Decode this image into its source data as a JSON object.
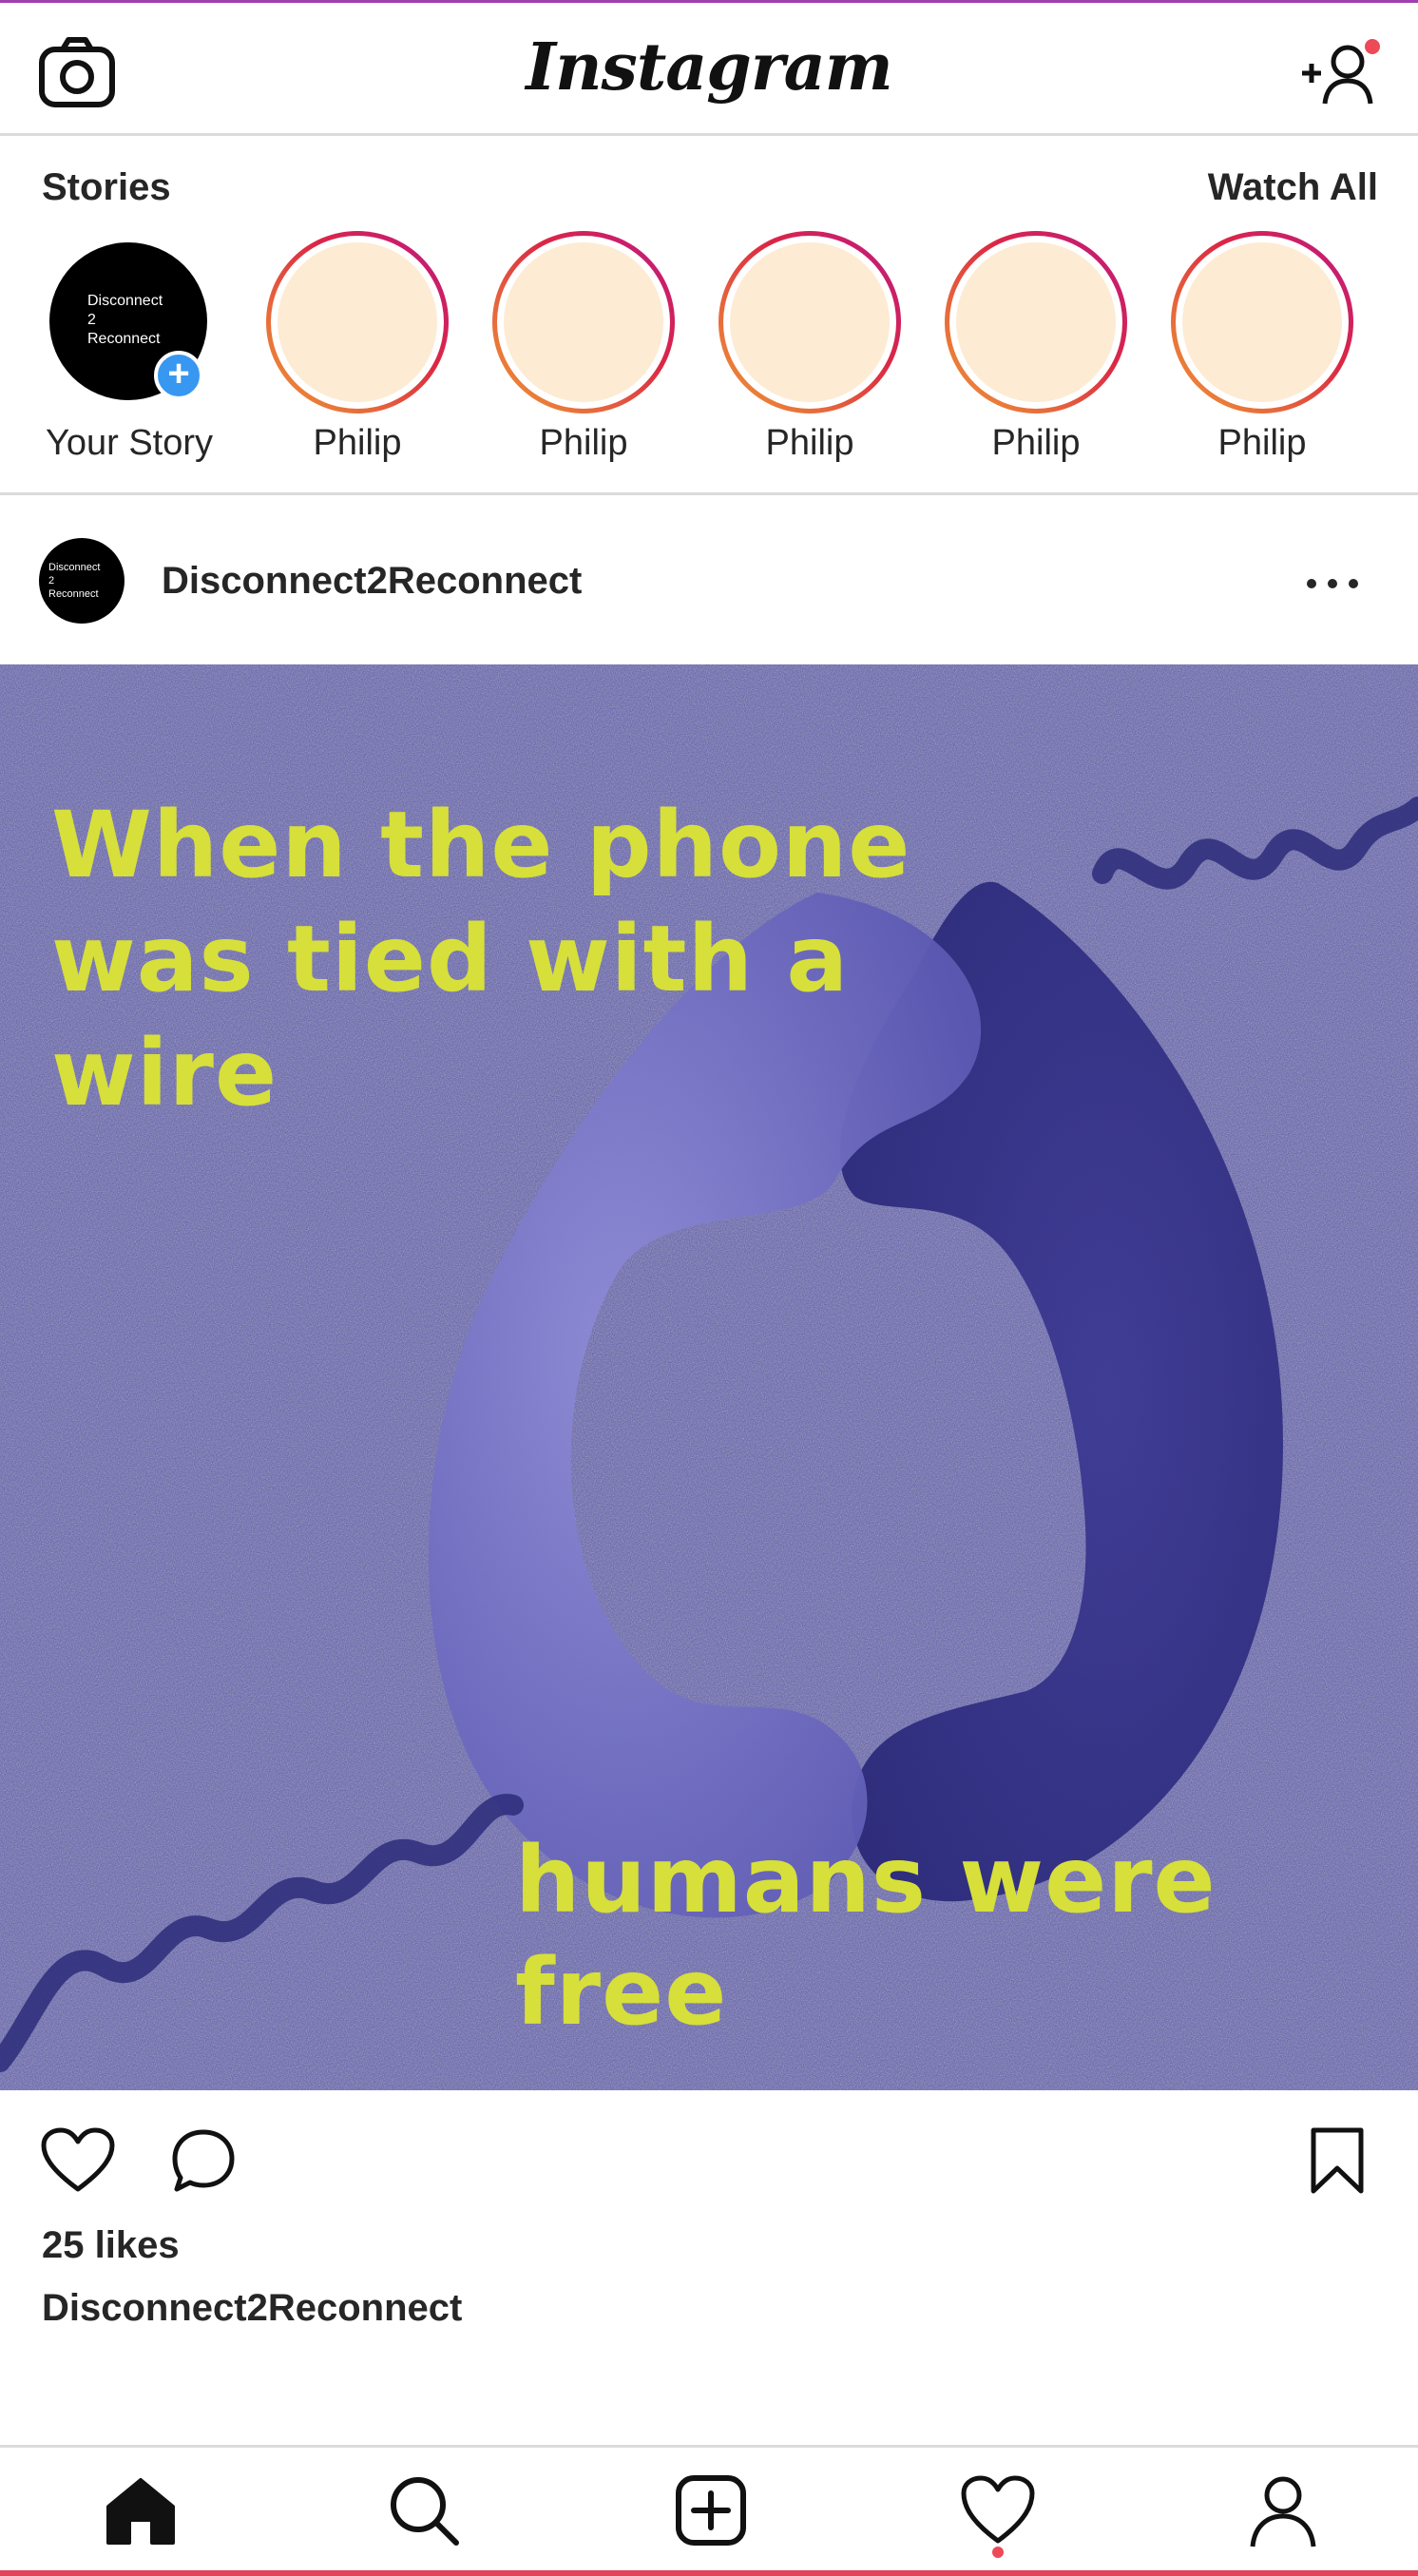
{
  "header": {
    "logo_text": "Instagram"
  },
  "stories": {
    "title": "Stories",
    "watch_all": "Watch All",
    "your_story": {
      "label": "Your Story",
      "avatar_text": [
        "Disconnect",
        "2",
        "Reconnect"
      ]
    },
    "items": [
      {
        "name": "Philip"
      },
      {
        "name": "Philip"
      },
      {
        "name": "Philip"
      },
      {
        "name": "Philip"
      },
      {
        "name": "Philip"
      }
    ]
  },
  "post": {
    "username": "Disconnect2Reconnect",
    "avatar_text": [
      "Disconnect",
      "2",
      "Reconnect"
    ],
    "image_text_top": "When the phone was tied with a wire",
    "image_text_bottom": "humans were free",
    "likes": "25 likes",
    "caption_username": "Disconnect2Reconnect"
  },
  "icons": {
    "header_left": "camera-icon",
    "header_right": "add-user-icon",
    "post_more": "more-options-icon",
    "actions": [
      "heart-icon",
      "comment-icon",
      "bookmark-icon"
    ],
    "nav": [
      "home-icon",
      "search-icon",
      "add-post-icon",
      "activity-heart-icon",
      "profile-icon"
    ]
  },
  "colors": {
    "story_ring_start": "#f09433",
    "story_ring_end": "#bc1888",
    "story_fill": "#fdebd3",
    "add_story_blue": "#3897f0",
    "notification_red": "#ed4956",
    "image_background": "#5855b0",
    "image_text": "#d7df3a"
  }
}
